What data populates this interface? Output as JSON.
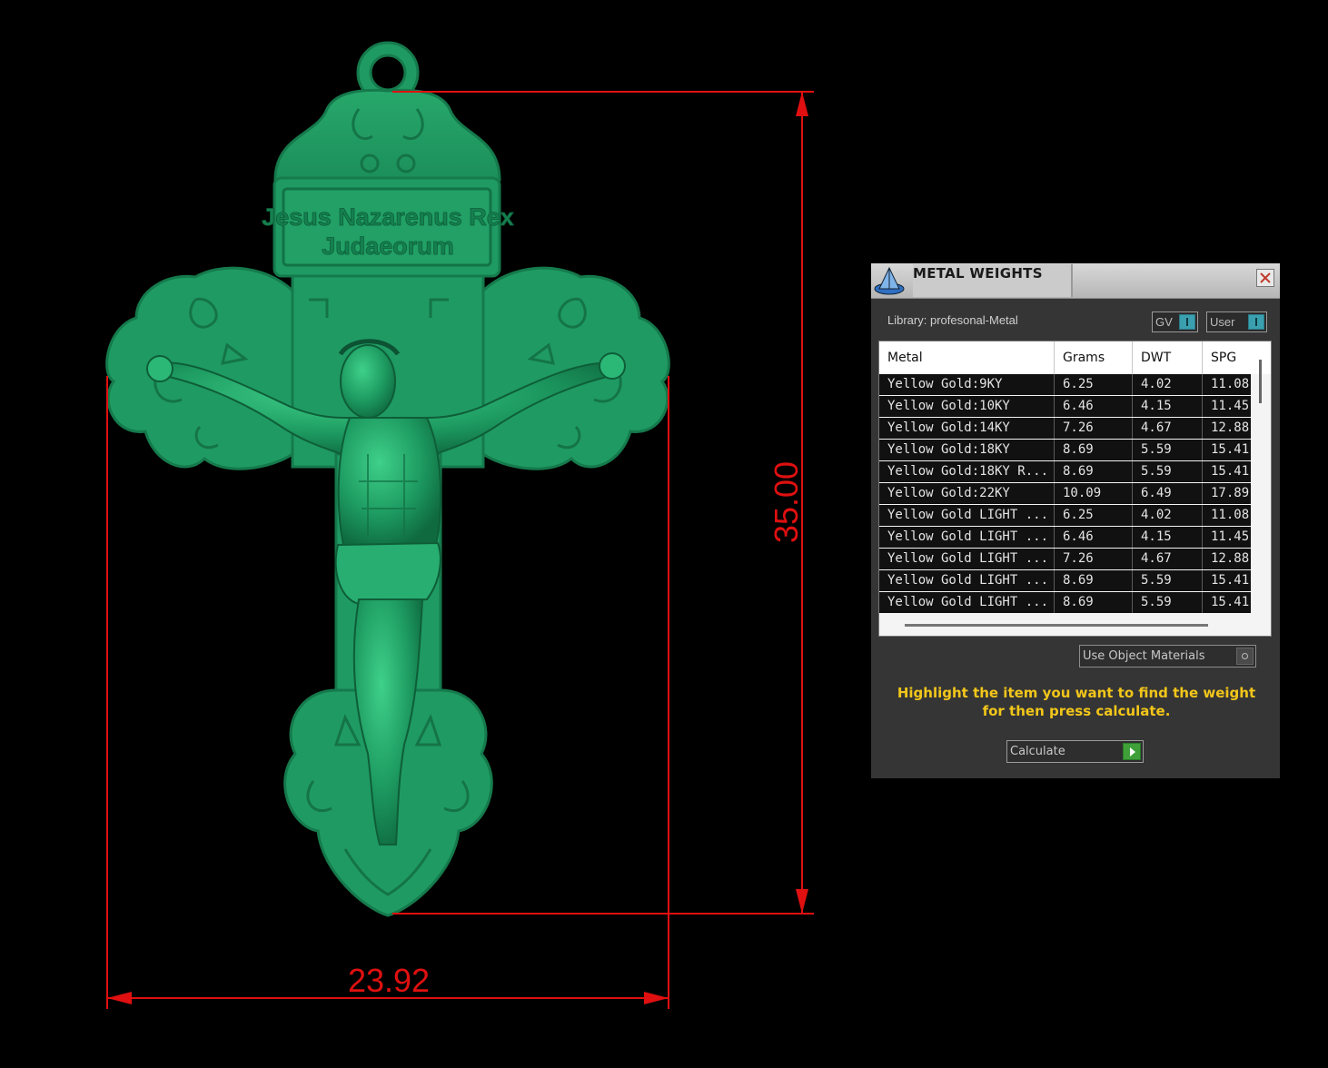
{
  "viewport": {
    "pendant": {
      "title_lines": [
        "Jesus Nazarenus Rex",
        "Judaeorum"
      ]
    },
    "dimensions": {
      "height_label": "35.00",
      "width_label": "23.92"
    },
    "colors": {
      "model": "#1f9a63",
      "dimension_lines": "#e01010"
    }
  },
  "panel": {
    "title": "METAL WEIGHTS",
    "library_label": "Library: profesonal-Metal",
    "toggles": [
      {
        "label": "GV"
      },
      {
        "label": "User"
      }
    ],
    "table": {
      "columns": [
        "Metal",
        "Grams",
        "DWT",
        "SPG"
      ],
      "rows": [
        [
          "Yellow Gold:9KY",
          "6.25",
          "4.02",
          "11.08"
        ],
        [
          "Yellow Gold:10KY",
          "6.46",
          "4.15",
          "11.45"
        ],
        [
          "Yellow Gold:14KY",
          "7.26",
          "4.67",
          "12.88"
        ],
        [
          "Yellow Gold:18KY",
          "8.69",
          "5.59",
          "15.41"
        ],
        [
          "Yellow Gold:18KY R...",
          "8.69",
          "5.59",
          "15.41"
        ],
        [
          "Yellow Gold:22KY",
          "10.09",
          "6.49",
          "17.89"
        ],
        [
          "Yellow Gold LIGHT ...",
          "6.25",
          "4.02",
          "11.08"
        ],
        [
          "Yellow Gold LIGHT ...",
          "6.46",
          "4.15",
          "11.45"
        ],
        [
          "Yellow Gold LIGHT ...",
          "7.26",
          "4.67",
          "12.88"
        ],
        [
          "Yellow Gold LIGHT ...",
          "8.69",
          "5.59",
          "15.41"
        ],
        [
          "Yellow Gold LIGHT ...",
          "8.69",
          "5.59",
          "15.41"
        ]
      ]
    },
    "use_object_materials_label": "Use Object Materials",
    "instructions": "Highlight the item you want to find the weight for then press calculate.",
    "calculate_label": "Calculate",
    "colors": {
      "panel_bg": "#353535",
      "instructions": "#f2c61a",
      "toggle_accent": "#3aa0b0",
      "calculate_accent": "#3fa03a"
    }
  }
}
